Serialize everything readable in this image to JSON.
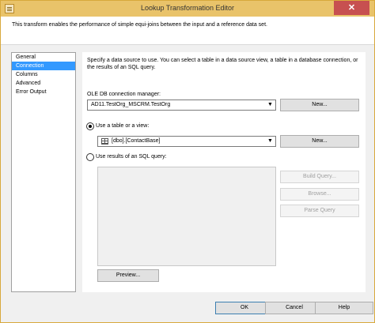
{
  "window": {
    "title": "Lookup Transformation Editor",
    "close_glyph": "✕"
  },
  "description": "This transform enables the performance of simple equi-joins between the input and a reference data set.",
  "nav": {
    "items": [
      {
        "label": "General",
        "selected": false
      },
      {
        "label": "Connection",
        "selected": true
      },
      {
        "label": "Columns",
        "selected": false
      },
      {
        "label": "Advanced",
        "selected": false
      },
      {
        "label": "Error Output",
        "selected": false
      }
    ]
  },
  "connection": {
    "intro": "Specify a data source to use. You can select a table in a data source view, a table in a database connection, or the results of an SQL query.",
    "oledb_label": "OLE DB connection manager:",
    "oledb_value": "AD11.TestOrg_MSCRM.TestOrg",
    "new_button": "New...",
    "table_radio_label": "Use a table or a view:",
    "table_value": "[dbo].[ContactBase]",
    "sql_radio_label": "Use results of an SQL query:",
    "sql_text": "",
    "build_query": "Build Query...",
    "browse": "Browse...",
    "parse_query": "Parse Query",
    "preview": "Preview...",
    "dropdown_glyph": "▼"
  },
  "footer": {
    "ok": "OK",
    "cancel": "Cancel",
    "help": "Help"
  }
}
